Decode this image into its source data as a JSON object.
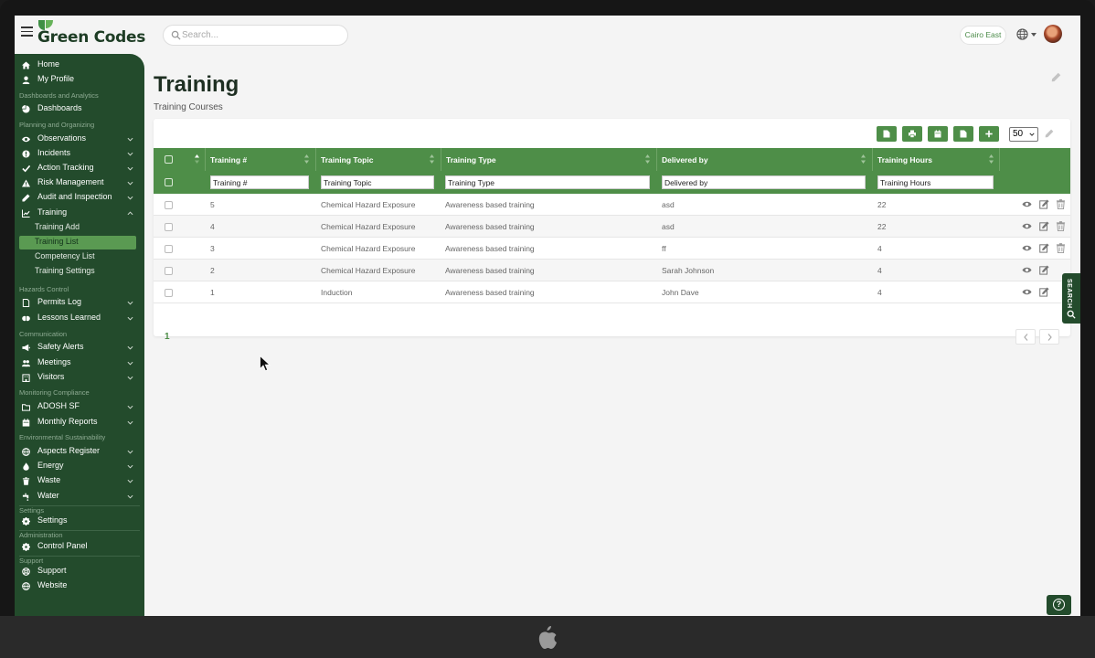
{
  "app": {
    "name": "Green Codes",
    "site": "Cairo East"
  },
  "search": {
    "placeholder": "Search..."
  },
  "sidebar": {
    "home": "Home",
    "my_profile": "My Profile",
    "sec_dashboards": "Dashboards and Analytics",
    "dashboards": "Dashboards",
    "sec_planning": "Planning and Organizing",
    "observations": "Observations",
    "incidents": "Incidents",
    "action_tracking": "Action Tracking",
    "risk_management": "Risk Management",
    "audit_inspection": "Audit and Inspection",
    "training": "Training",
    "training_add": "Training Add",
    "training_list": "Training List",
    "competency_list": "Competency List",
    "training_settings": "Training Settings",
    "sec_hazards": "Hazards Control",
    "permits_log": "Permits Log",
    "lessons_learned": "Lessons Learned",
    "sec_communication": "Communication",
    "safety_alerts": "Safety Alerts",
    "meetings": "Meetings",
    "visitors": "Visitors",
    "sec_monitoring": "Monitoring Compliance",
    "adosh_sf": "ADOSH SF",
    "monthly_reports": "Monthly Reports",
    "sec_environmental": "Environmental Sustainability",
    "aspects_register": "Aspects Register",
    "energy": "Energy",
    "waste": "Waste",
    "water": "Water",
    "sec_settings": "Settings",
    "settings": "Settings",
    "sec_administration": "Administration",
    "control_panel": "Control Panel",
    "sec_support": "Support",
    "support": "Support",
    "website": "Website"
  },
  "page": {
    "title": "Training",
    "subtitle": "Training Courses"
  },
  "table": {
    "page_size": "50",
    "columns": {
      "training_no": "Training #",
      "topic": "Training Topic",
      "type": "Training Type",
      "delivered_by": "Delivered by",
      "hours": "Training Hours"
    },
    "filters": {
      "training_no": "Training #",
      "topic": "Training Topic",
      "type": "Training Type",
      "delivered_by": "Delivered by",
      "hours": "Training Hours"
    },
    "rows": [
      {
        "no": "5",
        "topic": "Chemical Hazard Exposure",
        "type": "Awareness based training",
        "delivered_by": "asd",
        "hours": "22"
      },
      {
        "no": "4",
        "topic": "Chemical Hazard Exposure",
        "type": "Awareness based training",
        "delivered_by": "asd",
        "hours": "22"
      },
      {
        "no": "3",
        "topic": "Chemical Hazard Exposure",
        "type": "Awareness based training",
        "delivered_by": "ff",
        "hours": "4"
      },
      {
        "no": "2",
        "topic": "Chemical Hazard Exposure",
        "type": "Awareness based training",
        "delivered_by": "Sarah Johnson",
        "hours": "4"
      },
      {
        "no": "1",
        "topic": "Induction",
        "type": "Awareness based training",
        "delivered_by": "John Dave",
        "hours": "4"
      }
    ],
    "current_page": "1"
  },
  "widgets": {
    "search_tab": "SEARCH",
    "help": "?"
  },
  "colors": {
    "brand_dark": "#234b2c",
    "brand_green": "#4e8e48",
    "active_item": "#5a9a52"
  }
}
